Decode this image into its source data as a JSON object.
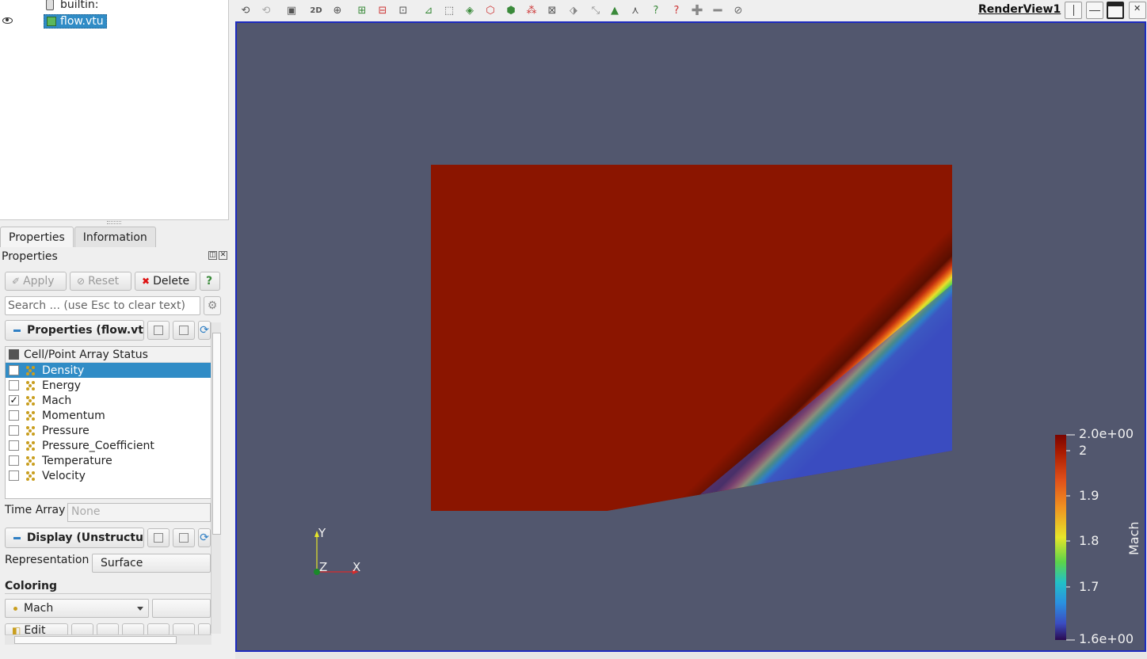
{
  "pipeline": {
    "server": "builtin:",
    "file": "flow.vtu"
  },
  "tabs": [
    "Properties",
    "Information"
  ],
  "panel": {
    "title": "Properties",
    "apply": "Apply",
    "reset": "Reset",
    "delete": "Delete",
    "help": "?",
    "search_placeholder": "Search ... (use Esc to clear text)",
    "section_properties": "Properties (flow.vt",
    "array_table_header": "Cell/Point Array Status",
    "arrays": [
      {
        "name": "Density",
        "checked": false,
        "selected": true
      },
      {
        "name": "Energy",
        "checked": false,
        "selected": false
      },
      {
        "name": "Mach",
        "checked": true,
        "selected": false
      },
      {
        "name": "Momentum",
        "checked": false,
        "selected": false
      },
      {
        "name": "Pressure",
        "checked": false,
        "selected": false
      },
      {
        "name": "Pressure_Coefficient",
        "checked": false,
        "selected": false
      },
      {
        "name": "Temperature",
        "checked": false,
        "selected": false
      },
      {
        "name": "Velocity",
        "checked": false,
        "selected": false
      }
    ],
    "time_array_label": "Time Array",
    "time_array_value": "None",
    "section_display": "Display (Unstructu",
    "representation_label": "Representation",
    "representation_value": "Surface",
    "coloring_label": "Coloring",
    "coloring_value": "Mach",
    "edit_label": "Edit"
  },
  "toolbar": {
    "twod_label": "2D",
    "render_view_title": "RenderView1"
  },
  "colorbar": {
    "title": "Mach",
    "ticks": [
      "2.0e+00",
      "2",
      "1.9",
      "1.8",
      "1.7",
      "1.6e+00"
    ]
  },
  "axes": {
    "x": "X",
    "y": "Y",
    "z": "Z"
  },
  "colors": {
    "background": "#52576e",
    "mach_high": "#8b1500",
    "mach_low": "#3b4cc0",
    "selection": "#308cc6"
  }
}
